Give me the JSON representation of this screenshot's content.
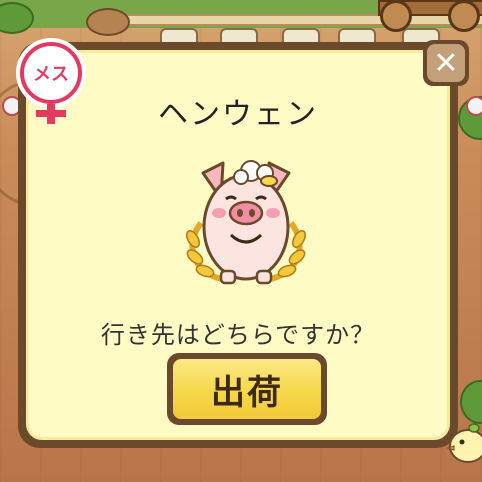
{
  "popup": {
    "pig_name": "ヘンウェン",
    "question": "行き先はどちらですか？",
    "ship_button_label": "出荷",
    "close_button_label": "✕"
  },
  "badge": {
    "gender_label": "メス",
    "color": "#e33a62"
  },
  "icons": {
    "close": "close-icon",
    "gender": "female-symbol-icon",
    "pig": "pig-portrait"
  },
  "colors": {
    "popup_border": "#6b4a2c",
    "popup_background": "#fefbc4",
    "button_yellow": "#f6d94c"
  }
}
